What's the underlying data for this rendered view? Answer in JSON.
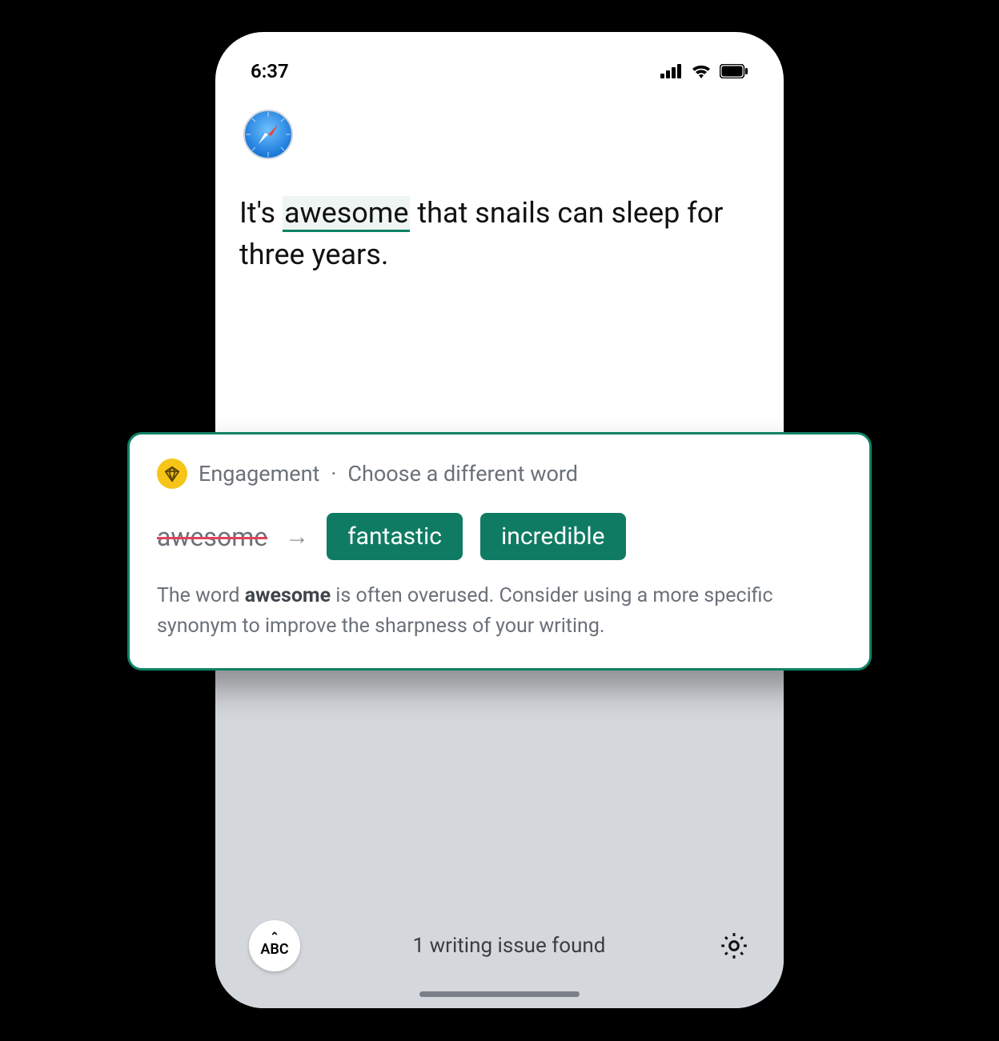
{
  "statusbar": {
    "time": "6:37"
  },
  "content": {
    "sentence_pre": "It's ",
    "highlight": "awesome",
    "sentence_post": " that snails can sleep for three years."
  },
  "card": {
    "category": "Engagement",
    "separator": "·",
    "tip": "Choose a different word",
    "original": "awesome",
    "suggestions": [
      "fantastic",
      "incredible"
    ],
    "desc_pre": "The word ",
    "desc_bold": "awesome",
    "desc_post": " is often overused. Consider using a more specific synonym to improve the sharpness of your writing."
  },
  "footer": {
    "abc_label": "ABC",
    "issue_text": "1 writing issue found"
  }
}
